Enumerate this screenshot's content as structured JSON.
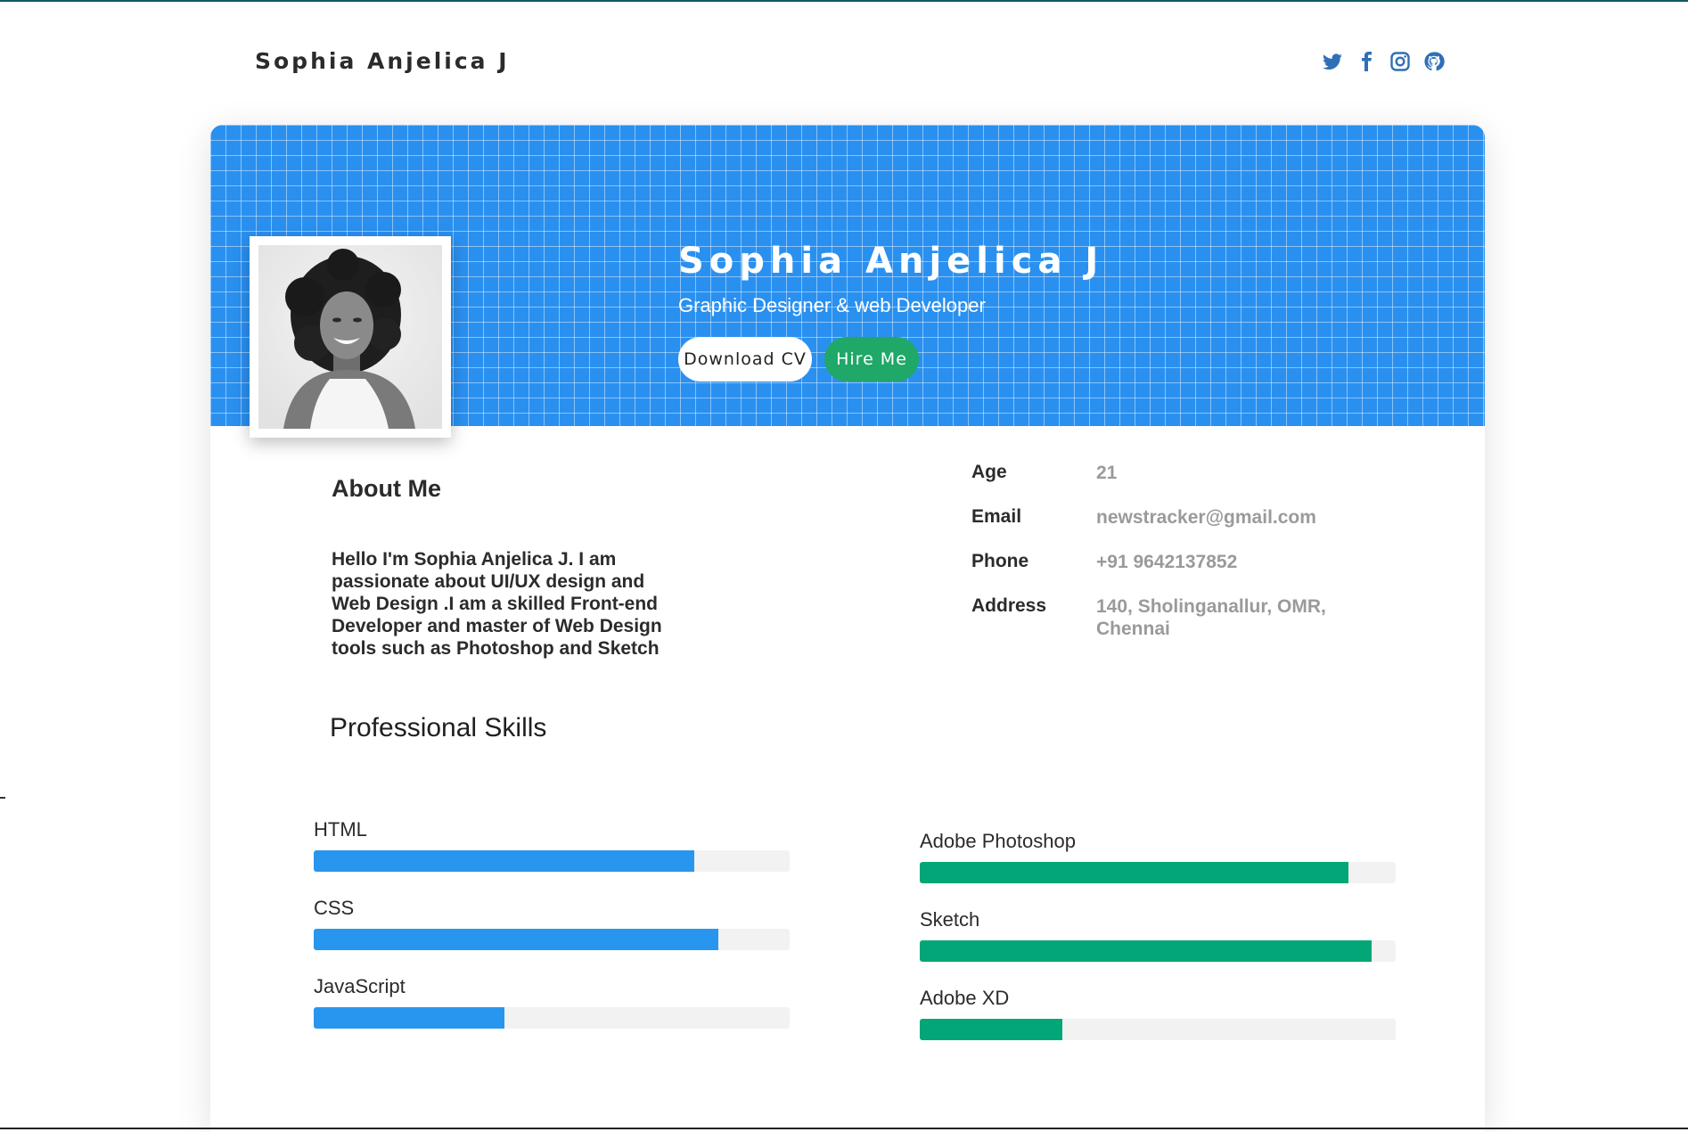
{
  "header": {
    "brand": "Sophia Anjelica J",
    "socials": [
      {
        "icon": "twitter-icon"
      },
      {
        "icon": "facebook-icon"
      },
      {
        "icon": "instagram-icon"
      },
      {
        "icon": "github-icon"
      }
    ]
  },
  "hero": {
    "name": "Sophia Anjelica J",
    "role": "Graphic Designer & web Developer",
    "download_label": "Download CV",
    "hire_label": "Hire Me",
    "photo_icon": "profile-photo"
  },
  "about": {
    "title": "About Me",
    "text": "Hello I'm Sophia Anjelica J. I am passionate about UI/UX design and Web Design .I am a skilled Front-end Developer and master of Web Design tools such as Photoshop and Sketch"
  },
  "info": [
    {
      "key": "Age",
      "value": "21"
    },
    {
      "key": "Email",
      "value": "newstracker@gmail.com"
    },
    {
      "key": "Phone",
      "value": "+91 9642137852"
    },
    {
      "key": "Address",
      "value": "140, Sholinganallur, OMR, Chennai"
    }
  ],
  "skills": {
    "title": "Professional Skills",
    "left": [
      {
        "name": "HTML",
        "level": 0.8
      },
      {
        "name": "CSS",
        "level": 0.85
      },
      {
        "name": "JavaScript",
        "level": 0.4
      }
    ],
    "right": [
      {
        "name": "Adobe Photoshop",
        "level": 0.9
      },
      {
        "name": "Sketch",
        "level": 0.95
      },
      {
        "name": "Adobe XD",
        "level": 0.3
      }
    ]
  },
  "colors": {
    "hero_bg": "#2a90f0",
    "accent_green": "#1fa868",
    "skill_blue": "#2896ef",
    "skill_green": "#03a676",
    "social_icon": "#2f6fb5"
  }
}
